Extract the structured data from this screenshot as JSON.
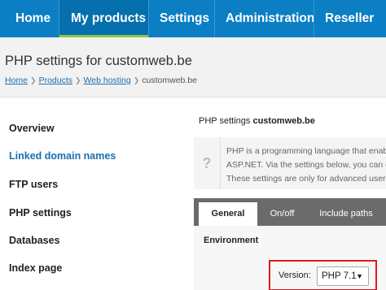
{
  "topnav": {
    "items": [
      {
        "label": "Home"
      },
      {
        "label": "My products"
      },
      {
        "label": "Settings"
      },
      {
        "label": "Administration"
      },
      {
        "label": "Reseller"
      }
    ],
    "active": "My products",
    "background_color": "#0b7ec4",
    "active_underline_color": "#8dc63f"
  },
  "header": {
    "title": "PHP settings for customweb.be",
    "breadcrumb": [
      "Home",
      "Products",
      "Web hosting",
      "customweb.be"
    ]
  },
  "sidebar": {
    "items": [
      {
        "label": "Overview"
      },
      {
        "label": "Linked domain names"
      },
      {
        "label": "FTP users"
      },
      {
        "label": "PHP settings"
      },
      {
        "label": "Databases"
      },
      {
        "label": "Index page"
      }
    ]
  },
  "main": {
    "heading_prefix": "PHP settings",
    "heading_domain": "customweb.be",
    "info": {
      "icon": "question-icon",
      "lines": [
        "PHP is a programming language that enabl",
        "ASP.NET. Via the settings below, you can e",
        "These settings are only for advanced users"
      ]
    },
    "tabs": [
      {
        "label": "General"
      },
      {
        "label": "On/off"
      },
      {
        "label": "Include paths"
      }
    ],
    "active_tab": "General",
    "section_label": "Environment",
    "version": {
      "label": "Version:",
      "selected": "PHP 7.1"
    },
    "highlight_color": "#e0191f"
  }
}
